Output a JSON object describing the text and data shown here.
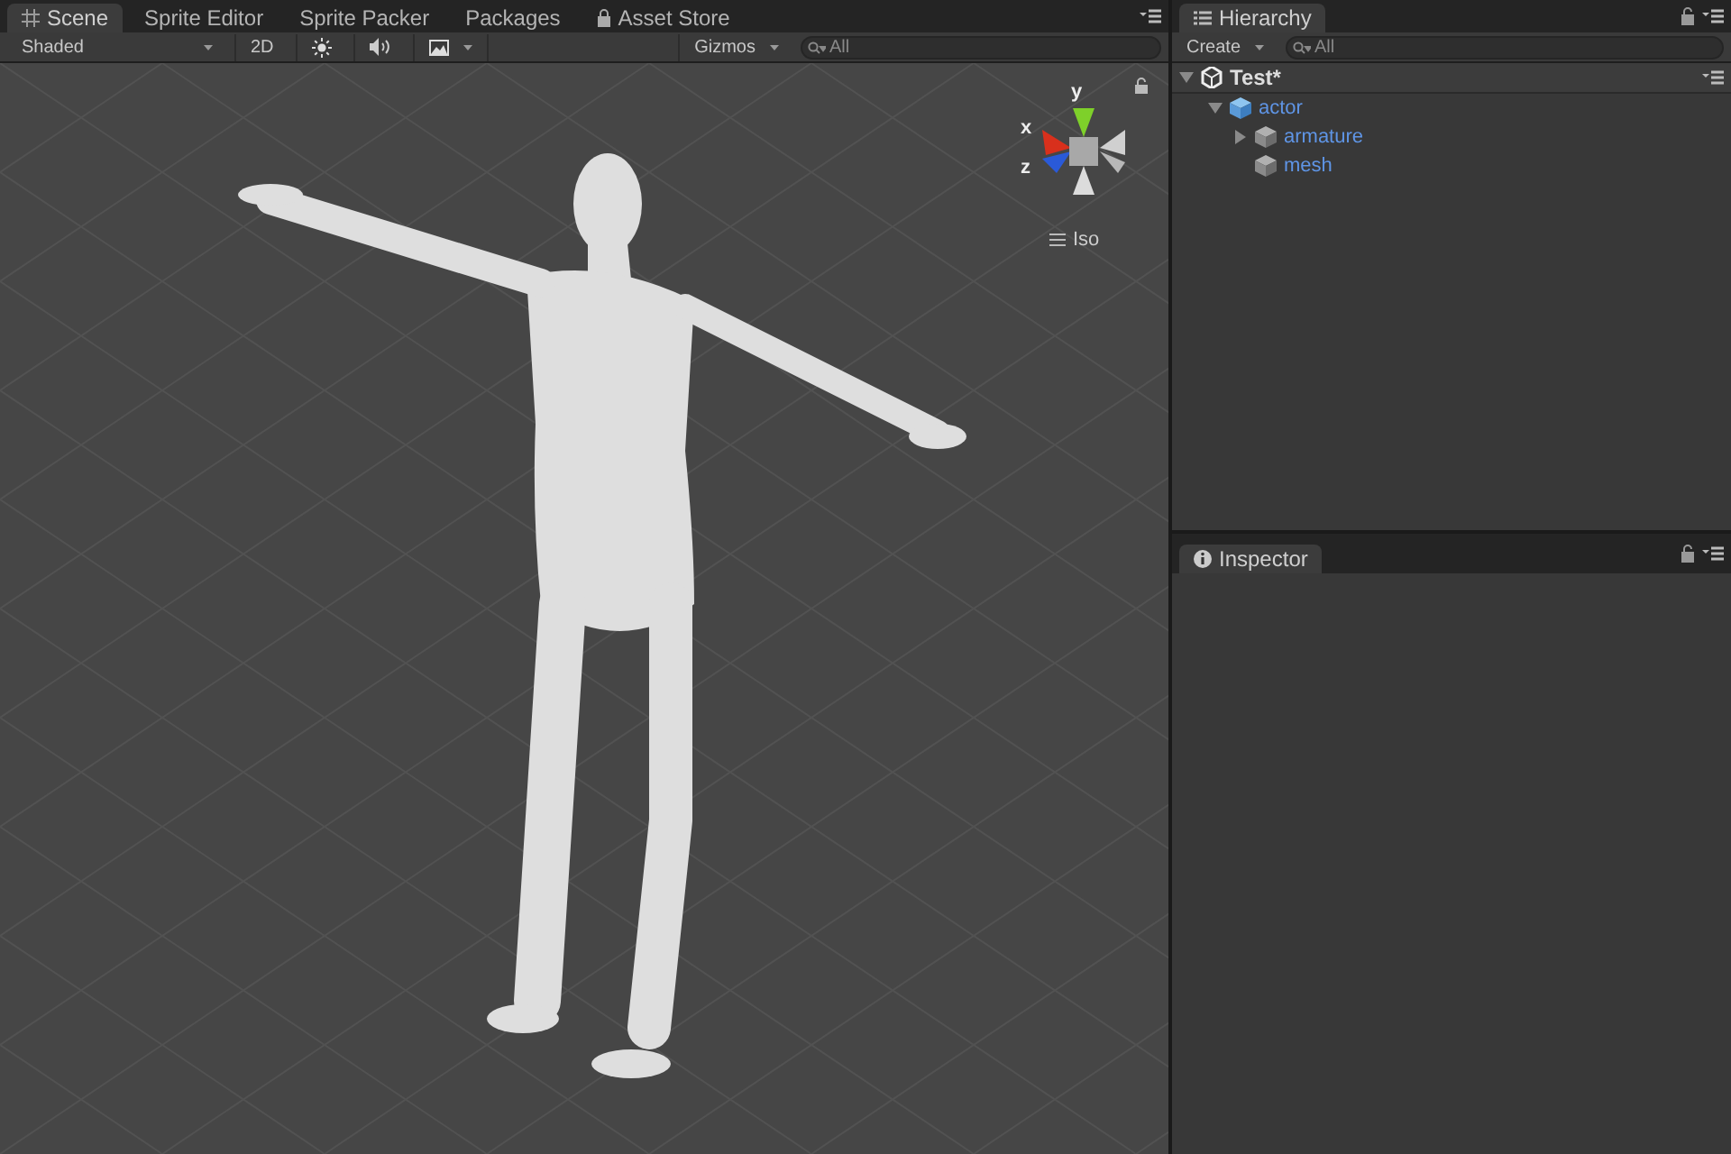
{
  "scene_window": {
    "tabs": [
      {
        "label": "Scene",
        "selected": true
      },
      {
        "label": "Sprite Editor",
        "selected": false
      },
      {
        "label": "Sprite Packer",
        "selected": false
      },
      {
        "label": "Packages",
        "selected": false
      },
      {
        "label": "Asset Store",
        "selected": false
      }
    ],
    "toolbar": {
      "draw_mode": "Shaded",
      "mode_2d": "2D",
      "gizmos": "Gizmos",
      "search_placeholder": "All"
    },
    "gizmo": {
      "y_label": "y",
      "x_label": "x",
      "z_label": "z",
      "projection": "Iso"
    }
  },
  "hierarchy": {
    "tab": "Hierarchy",
    "create": "Create",
    "search_placeholder": "All",
    "scene": {
      "name": "Test*",
      "expanded": true,
      "children": [
        {
          "name": "actor",
          "expanded": true,
          "kind": "prefab",
          "children": [
            {
              "name": "armature",
              "expanded": false,
              "kind": "object"
            },
            {
              "name": "mesh",
              "kind": "object"
            }
          ]
        }
      ]
    }
  },
  "inspector": {
    "tab": "Inspector"
  }
}
